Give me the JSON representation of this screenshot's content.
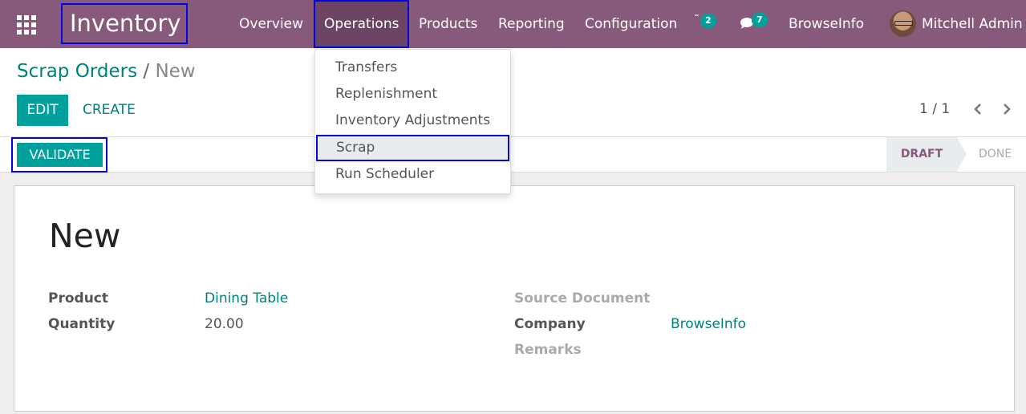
{
  "navbar": {
    "app_title": "Inventory",
    "menu": [
      "Overview",
      "Operations",
      "Products",
      "Reporting",
      "Configuration"
    ],
    "activity_count": "2",
    "message_count": "7",
    "company": "BrowseInfo",
    "user": "Mitchell Admin",
    "colors": {
      "bar": "#875a7b",
      "active": "#6b4563",
      "badge": "#00a09d"
    }
  },
  "operations_menu": {
    "items": [
      "Transfers",
      "Replenishment",
      "Inventory Adjustments",
      "Scrap",
      "Run Scheduler"
    ],
    "highlighted": "Scrap"
  },
  "control_panel": {
    "breadcrumb": {
      "parent": "Scrap Orders",
      "separator": "/",
      "current": "New"
    },
    "edit_label": "EDIT",
    "create_label": "CREATE",
    "pager": "1 / 1"
  },
  "statusbar": {
    "validate_label": "VALIDATE",
    "stages": [
      "DRAFT",
      "DONE"
    ],
    "current_stage": "DRAFT"
  },
  "form": {
    "title": "New",
    "product_label": "Product",
    "product_value": "Dining Table",
    "quantity_label": "Quantity",
    "quantity_value": "20.00",
    "source_document_label": "Source Document",
    "company_label": "Company",
    "company_value": "BrowseInfo",
    "remarks_label": "Remarks"
  },
  "icons": [
    "apps-grid-icon",
    "activity-icon",
    "chat-icon",
    "chevron-left-icon",
    "chevron-right-icon"
  ]
}
